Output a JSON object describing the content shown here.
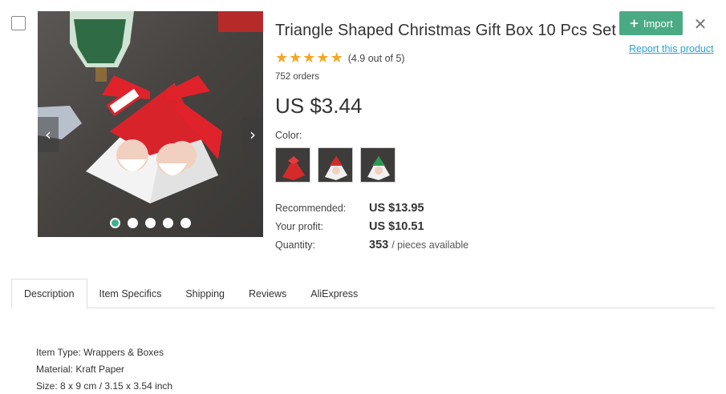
{
  "product": {
    "title": "Triangle Shaped Christmas Gift Box 10 Pcs Set",
    "rating_text": "(4.9 out of 5)",
    "stars": 5,
    "orders": "752 orders",
    "price": "US $3.44",
    "color_label": "Color:",
    "color_swatches": [
      "red-gift-box",
      "red-white-gift-box",
      "green-white-gift-box"
    ]
  },
  "gallery": {
    "slide_count": 5,
    "active_slide": 1,
    "prev_icon": "chevron-left-icon",
    "next_icon": "chevron-right-icon"
  },
  "pricing": {
    "recommended_label": "Recommended:",
    "recommended_value": "US $13.95",
    "profit_label": "Your profit:",
    "profit_value": "US $10.51",
    "quantity_label": "Quantity:",
    "quantity_value": "353",
    "quantity_unit": "/ pieces available"
  },
  "actions": {
    "import_label": "Import",
    "import_icon": "plus-icon",
    "close_icon": "close-icon",
    "report_label": "Report this product"
  },
  "tabs": [
    {
      "label": "Description",
      "active": true
    },
    {
      "label": "Item Specifics",
      "active": false
    },
    {
      "label": "Shipping",
      "active": false
    },
    {
      "label": "Reviews",
      "active": false
    },
    {
      "label": "AliExpress",
      "active": false
    }
  ],
  "description": {
    "lines": [
      "Item Type: Wrappers & Boxes",
      "Material: Kraft Paper",
      "Size: 8 x 9 cm / 3.15 x 3.54 inch"
    ]
  },
  "colors": {
    "accent": "#4aaa84",
    "link": "#2aa3d6",
    "star": "#f5a623",
    "dot_active": "#3db191"
  }
}
